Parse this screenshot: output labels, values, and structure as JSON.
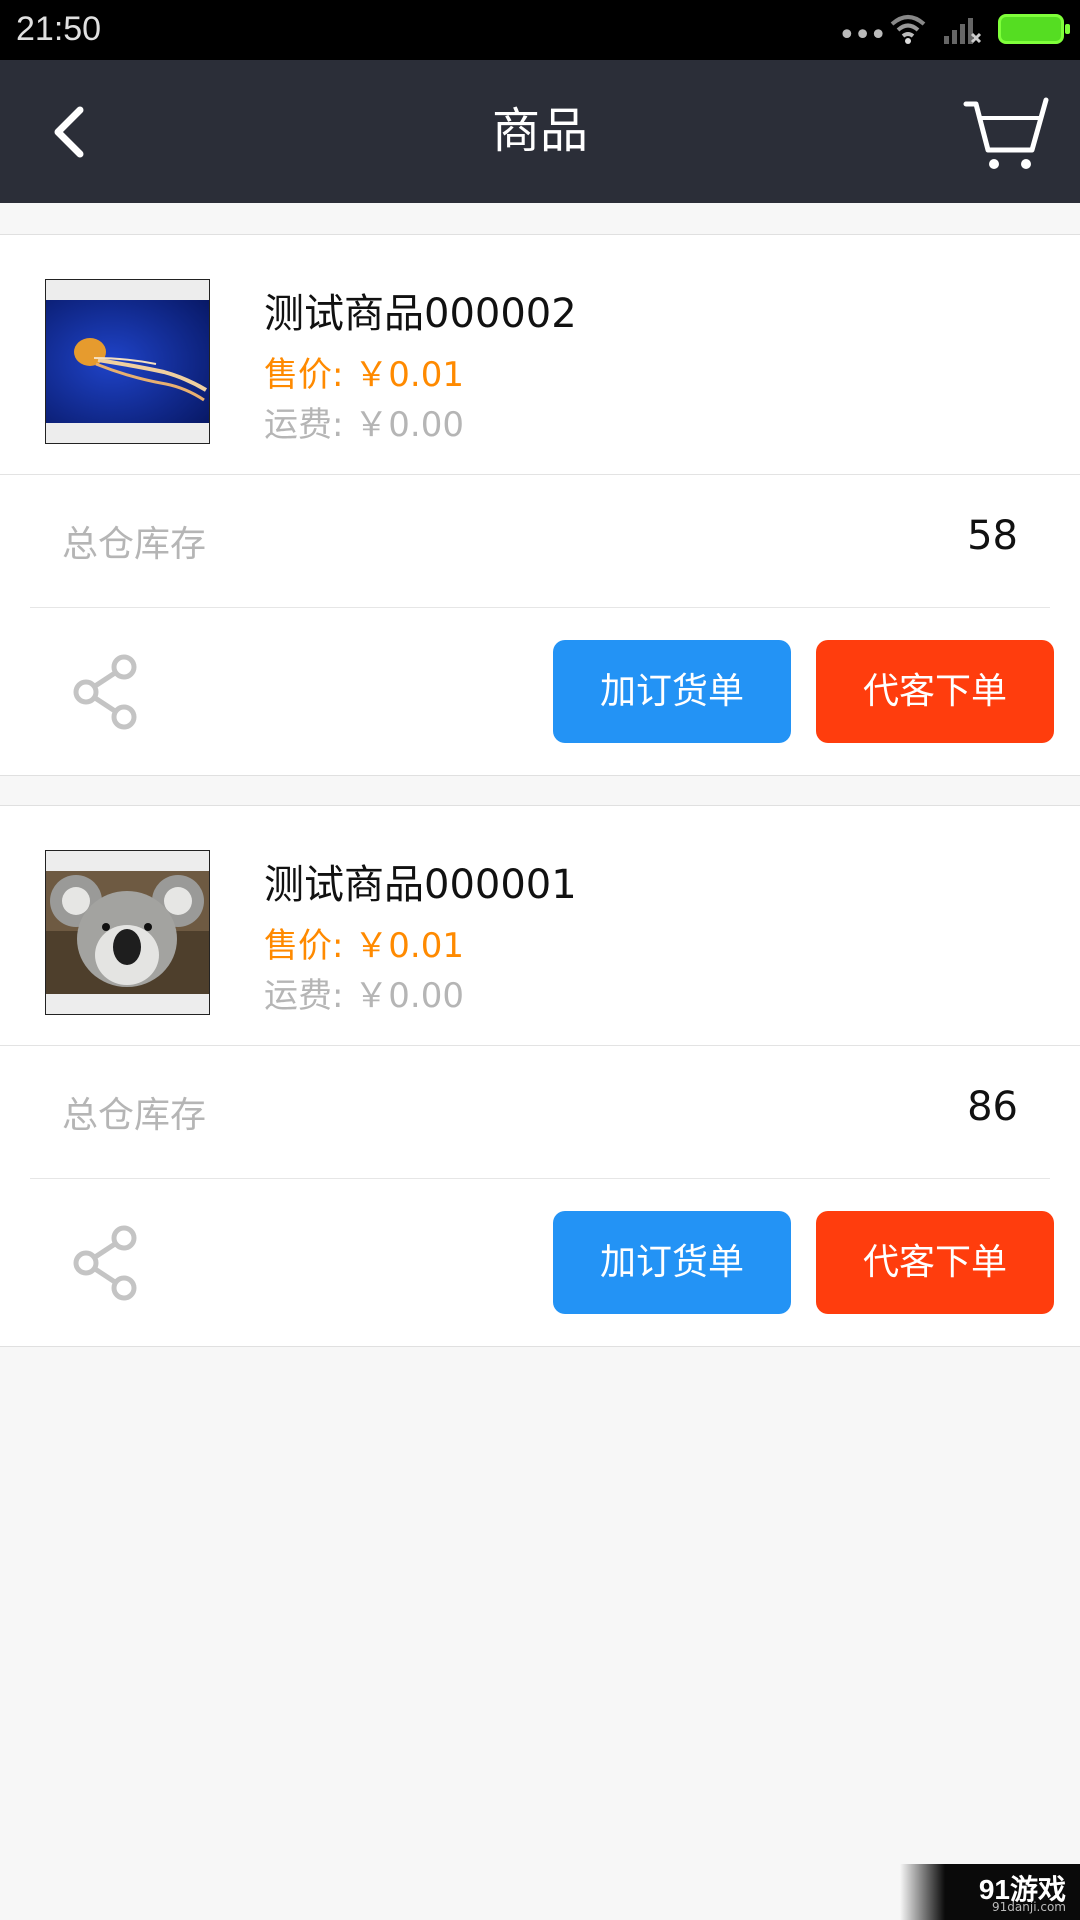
{
  "status_bar": {
    "time": "21:50",
    "more_dots": "•••",
    "icons": [
      "wifi-icon",
      "signal-icon",
      "battery-icon"
    ],
    "battery_color": "#55dd22"
  },
  "header": {
    "title": "商品",
    "back_icon": "chevron-left-icon",
    "cart_icon": "shopping-cart-icon",
    "background": "#2b2e38"
  },
  "products": [
    {
      "name": "测试商品000002",
      "price": "售价: ￥0.01",
      "freight": "运费: ￥0.00",
      "image": "jellyfish-photo",
      "stock_label": "总仓库存",
      "stock_value": "58",
      "share_icon": "share-icon",
      "add_order_label": "加订货单",
      "place_order_label": "代客下单"
    },
    {
      "name": "测试商品000001",
      "price": "售价: ￥0.01",
      "freight": "运费: ￥0.00",
      "image": "koala-photo",
      "stock_label": "总仓库存",
      "stock_value": "86",
      "share_icon": "share-icon",
      "add_order_label": "加订货单",
      "place_order_label": "代客下单"
    }
  ],
  "colors": {
    "price": "#ff8a00",
    "add_order_button": "#2393f5",
    "place_order_button": "#ff3d0d"
  },
  "watermark": {
    "brand": "91游戏",
    "site": "91danji.com"
  }
}
